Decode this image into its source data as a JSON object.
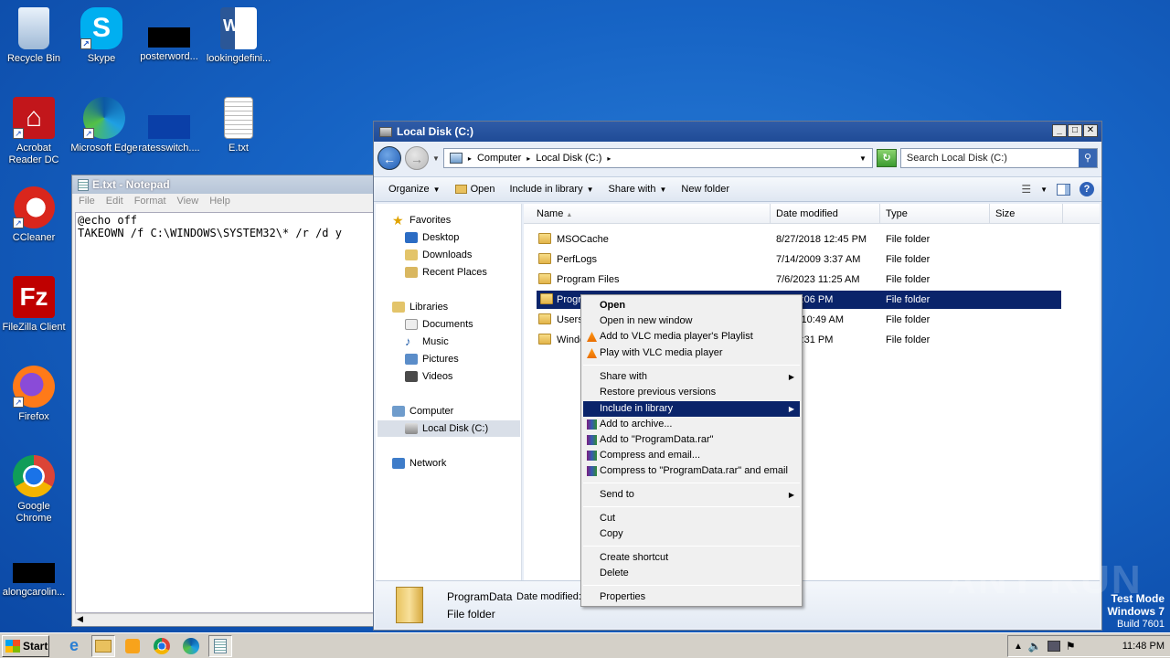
{
  "desktop_icons": [
    {
      "label": "Recycle Bin",
      "icon": "recycle-bin-icon"
    },
    {
      "label": "Skype",
      "icon": "skype-icon"
    },
    {
      "label": "posterword...",
      "icon": "black-file-icon"
    },
    {
      "label": "lookingdefini...",
      "icon": "word-doc-icon"
    },
    {
      "label": "Acrobat Reader DC",
      "icon": "acrobat-icon"
    },
    {
      "label": "Microsoft Edge",
      "icon": "edge-icon"
    },
    {
      "label": "ratesswitch....",
      "icon": "blue-file-icon"
    },
    {
      "label": "E.txt",
      "icon": "text-file-icon"
    },
    {
      "label": "CCleaner",
      "icon": "ccleaner-icon"
    },
    {
      "label": "FileZilla Client",
      "icon": "filezilla-icon"
    },
    {
      "label": "Firefox",
      "icon": "firefox-icon"
    },
    {
      "label": "Google Chrome",
      "icon": "chrome-icon"
    },
    {
      "label": "alongcarolin...",
      "icon": "black-file-icon"
    }
  ],
  "notepad": {
    "title": "E.txt - Notepad",
    "menu": [
      "File",
      "Edit",
      "Format",
      "View",
      "Help"
    ],
    "content": "@echo off\nTAKEOWN /f C:\\WINDOWS\\SYSTEM32\\* /r /d y"
  },
  "explorer": {
    "title": "Local Disk (C:)",
    "breadcrumb": [
      "Computer",
      "Local Disk (C:)"
    ],
    "search_placeholder": "Search Local Disk (C:)",
    "toolbar": {
      "organize": "Organize",
      "open": "Open",
      "include": "Include in library",
      "share": "Share with",
      "new_folder": "New folder"
    },
    "nav": {
      "favorites": "Favorites",
      "desktop": "Desktop",
      "downloads": "Downloads",
      "recent": "Recent Places",
      "libraries": "Libraries",
      "documents": "Documents",
      "music": "Music",
      "pictures": "Pictures",
      "videos": "Videos",
      "computer": "Computer",
      "localdisk": "Local Disk (C:)",
      "network": "Network"
    },
    "columns": {
      "name": "Name",
      "date": "Date modified",
      "type": "Type",
      "size": "Size"
    },
    "files": [
      {
        "name": "MSOCache",
        "date": "8/27/2018 12:45 PM",
        "type": "File folder"
      },
      {
        "name": "PerfLogs",
        "date": "7/14/2009 3:37 AM",
        "type": "File folder"
      },
      {
        "name": "Program Files",
        "date": "7/6/2023 11:25 AM",
        "type": "File folder"
      },
      {
        "name": "Progr",
        "date": "023 3:06 PM",
        "type": "File folder"
      },
      {
        "name": "Users",
        "date": "2017 10:49 AM",
        "type": "File folder"
      },
      {
        "name": "Windo",
        "date": "023 5:31 PM",
        "type": "File folder"
      }
    ],
    "details": {
      "name": "ProgramData",
      "date_label": "Date modified:",
      "type": "File folder"
    }
  },
  "context_menu": {
    "open": "Open",
    "open_new_window": "Open in new window",
    "vlc_playlist": "Add to VLC media player's Playlist",
    "vlc_play": "Play with VLC media player",
    "share_with": "Share with",
    "restore": "Restore previous versions",
    "include": "Include in library",
    "add_archive": "Add to archive...",
    "add_rar": "Add to \"ProgramData.rar\"",
    "compress_email": "Compress and email...",
    "compress_rar_email": "Compress to \"ProgramData.rar\" and email",
    "send_to": "Send to",
    "cut": "Cut",
    "copy": "Copy",
    "create_shortcut": "Create shortcut",
    "delete": "Delete",
    "properties": "Properties"
  },
  "watermark": "ANY RUN",
  "test_mode": {
    "line1": "Test Mode",
    "line2": "Windows 7",
    "line3": "Build 7601"
  },
  "taskbar": {
    "start": "Start",
    "clock": "11:48 PM"
  },
  "colors": {
    "selection": "#0a246a",
    "title_active": "#2f5ca8",
    "desktop": "#1663c4"
  }
}
